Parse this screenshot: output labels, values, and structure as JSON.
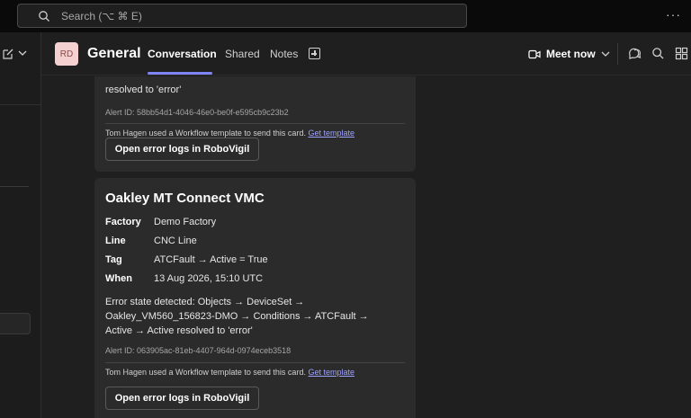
{
  "titlebar": {
    "search_placeholder": "Search (⌥ ⌘ E)",
    "more_label": "···"
  },
  "channel": {
    "avatar_initials": "RD",
    "name": "General",
    "tabs": [
      {
        "label": "Conversation",
        "active": true
      },
      {
        "label": "Shared",
        "active": false
      },
      {
        "label": "Notes",
        "active": false
      }
    ],
    "meet_now": "Meet now"
  },
  "cards": [
    {
      "message_tail": "resolved to 'error'",
      "alert_id": "Alert ID: 58bb54d1-4046-46e0-be0f-e595cb9c23b2",
      "footer_text": "Tom Hagen used a Workflow template to send this card.",
      "footer_link": "Get template",
      "button_label": "Open error logs in RoboVigil"
    },
    {
      "title": "Oakley MT Connect VMC",
      "facts": [
        {
          "key": "Factory",
          "value": "Demo Factory"
        },
        {
          "key": "Line",
          "value": "CNC Line"
        },
        {
          "key": "Tag",
          "value": "ATCFault → Active = True"
        },
        {
          "key": "When",
          "value": "13 Aug 2026, 15:10 UTC"
        }
      ],
      "message_lines": [
        "Error state detected: Objects → DeviceSet →",
        "Oakley_VM560_156823-DMO → Conditions → ATCFault →",
        "Active → Active resolved to 'error'"
      ],
      "alert_id": "Alert ID: 063905ac-81eb-4407-964d-0974eceb3518",
      "footer_text": "Tom Hagen used a Workflow template to send this card.",
      "footer_link": "Get template",
      "button_label": "Open error logs in RoboVigil"
    }
  ],
  "colors": {
    "accent": "#7f85f5",
    "link": "#9ea2ff",
    "card_bg": "#2b2b2b",
    "app_bg": "#1f1f1f"
  }
}
